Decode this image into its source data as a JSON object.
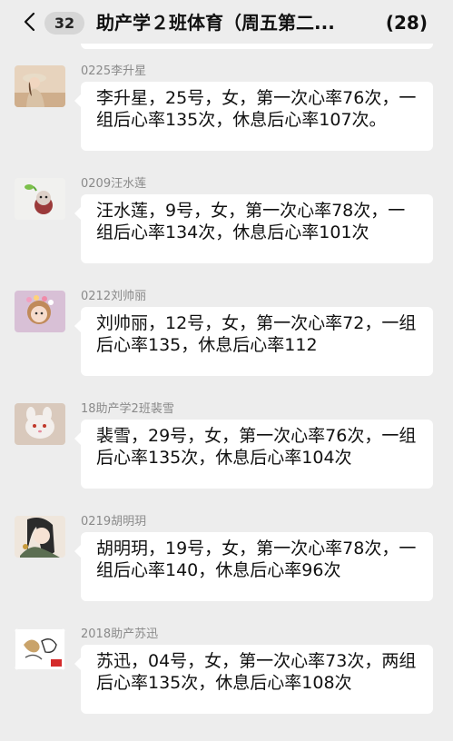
{
  "header": {
    "unread_count": "32",
    "title": "助产学２班体育（周五第二...",
    "member_count": "(28)"
  },
  "messages": [
    {
      "sender": "0225李升星",
      "text": "李升星，25号，女，第一次心率76次，一组后心率135次，休息后心率107次。",
      "avatar": "avatar-woman-hat"
    },
    {
      "sender": "0209汪水莲",
      "text": "汪水莲，9号，女，第一次心率78次，一组后心率134次，休息后心率101次",
      "avatar": "avatar-figurine"
    },
    {
      "sender": "0212刘帅丽",
      "text": "刘帅丽，12号，女，第一次心率72，一组后心率135，休息后心率112",
      "avatar": "avatar-girl-flowers"
    },
    {
      "sender": "18助产学2班裴雪",
      "text": "裴雪，29号，女，第一次心率76次，一组后心率135次，休息后心率104次",
      "avatar": "avatar-cartoon-bunny"
    },
    {
      "sender": "0219胡明玥",
      "text": "胡明玥，19号，女，第一次心率78次，一组后心率140，休息后心率96次",
      "avatar": "avatar-anime-girl"
    },
    {
      "sender": "2018助产苏迅",
      "text": "苏迅，04号，女，第一次心率73次，两组后心率135次，休息后心率108次",
      "avatar": "avatar-sketch-animals"
    }
  ],
  "colors": {
    "background": "#ededed",
    "bubble": "#ffffff",
    "sender_text": "#8a8a8a"
  }
}
